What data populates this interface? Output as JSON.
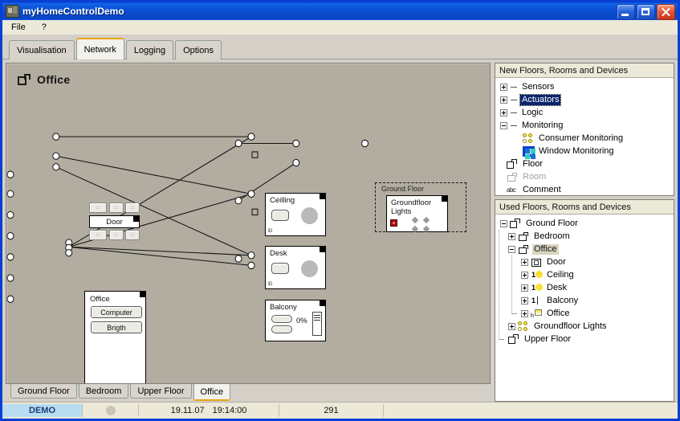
{
  "window": {
    "title": "myHomeControlDemo",
    "buttons": {
      "minimize": "minimize",
      "maximize": "maximize",
      "close": "close"
    }
  },
  "menu": {
    "items": [
      "File",
      "?"
    ]
  },
  "tabs": {
    "items": [
      "Visualisation",
      "Network",
      "Logging",
      "Options"
    ],
    "active": "Network"
  },
  "canvas": {
    "title": "Office",
    "nodes": {
      "door": {
        "label": "Door",
        "top_buttons": [
          "□",
          "□",
          "□"
        ],
        "bottom_buttons": [
          "□",
          "□",
          "□"
        ]
      },
      "office": {
        "label": "Office",
        "buttons": [
          "Computer",
          "Brigth"
        ]
      },
      "ceiling": {
        "label": "Ceilling",
        "io": "IO"
      },
      "desk": {
        "label": "Desk",
        "io": "IO"
      },
      "balcony": {
        "label": "Balcony",
        "value": "0%"
      },
      "groundfloor_lights": {
        "label": "Groundfloor\nLights",
        "line1": "Groundfloor",
        "line2": "Lights"
      }
    },
    "group": {
      "label": "Ground Floor"
    }
  },
  "bottom_tabs": {
    "items": [
      "Ground Floor",
      "Bedroom",
      "Upper Floor",
      "Office"
    ],
    "active": "Office"
  },
  "new_panel": {
    "title": "New Floors, Rooms and Devices",
    "items": [
      {
        "label": "Sensors",
        "state": "normal",
        "icon": "expand-plus-icon"
      },
      {
        "label": "Actuators",
        "state": "selected",
        "icon": "expand-plus-icon"
      },
      {
        "label": "Logic",
        "state": "normal",
        "icon": "expand-plus-icon"
      },
      {
        "label": "Monitoring",
        "state": "normal",
        "icon": "expand-minus-icon"
      },
      {
        "label": "Consumer Monitoring",
        "state": "normal",
        "icon": "consumer-monitoring-icon"
      },
      {
        "label": "Window Monitoring",
        "state": "normal",
        "icon": "window-monitoring-icon"
      },
      {
        "label": "Floor",
        "state": "normal",
        "icon": "floor-icon"
      },
      {
        "label": "Room",
        "state": "disabled",
        "icon": "room-icon"
      },
      {
        "label": "Comment",
        "state": "normal",
        "icon": "abc-comment-icon"
      }
    ],
    "comment_icon_text": "abc"
  },
  "used_panel": {
    "title": "Used Floors, Rooms and Devices",
    "items": [
      {
        "label": "Ground Floor",
        "icon": "floor-icon"
      },
      {
        "label": "Bedroom",
        "icon": "room-icon"
      },
      {
        "label": "Office",
        "icon": "room-icon",
        "state": "highlight"
      },
      {
        "label": "Door",
        "icon": "door-icon"
      },
      {
        "label": "Ceiling",
        "icon": "lamp-icon",
        "badge": "1"
      },
      {
        "label": "Desk",
        "icon": "lamp-icon",
        "badge": "1"
      },
      {
        "label": "Balcony",
        "icon": "blind-icon",
        "badge": "1"
      },
      {
        "label": "Office",
        "icon": "dimmer-icon",
        "badge": "h"
      },
      {
        "label": "Groundfloor Lights",
        "icon": "lights-icon"
      },
      {
        "label": "Upper Floor",
        "icon": "floor-icon"
      }
    ]
  },
  "status": {
    "mode": "DEMO",
    "indicator": "status-led",
    "date": "19.11.07",
    "time": "19:14:00",
    "counter": "291"
  },
  "colors": {
    "titlebar": "#0a4ed3",
    "accent": "#e8a317",
    "selection": "#0a246a",
    "canvas": "#b2ada0",
    "demo": "#b8dcf0",
    "alarm": "#a40e0e"
  }
}
